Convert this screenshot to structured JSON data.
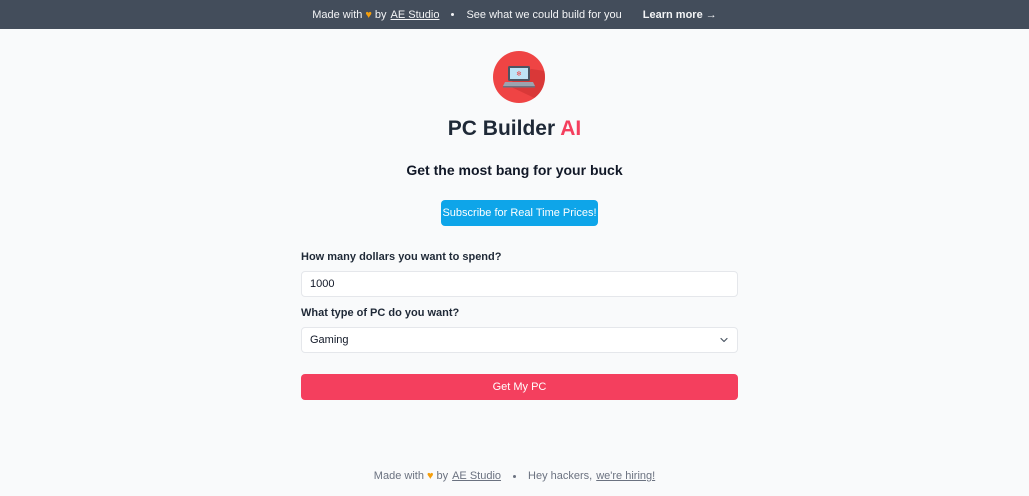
{
  "banner": {
    "made_with": "Made with",
    "heart_icon": "orange-heart",
    "by": "by",
    "studio_link": "AE Studio",
    "pitch": "See what we could build for you",
    "learn_more": "Learn more →"
  },
  "logo": {
    "icon": "laptop-icon",
    "bg_color": "#ef4444"
  },
  "title": {
    "main": "PC Builder",
    "accent": "AI",
    "accent_color": "#f43f5e"
  },
  "subtitle": "Get the most bang for your buck",
  "subscribe_button": "Subscribe for Real Time Prices!",
  "form": {
    "budget_label": "How many dollars you want to spend?",
    "budget_value": "1000",
    "type_label": "What type of PC do you want?",
    "type_selected": "Gaming"
  },
  "submit_button": "Get My PC",
  "footer": {
    "made_with": "Made with",
    "by": "by",
    "studio_link": "AE Studio",
    "hackers": "Hey hackers,",
    "hiring_link": "we're hiring!"
  },
  "colors": {
    "banner_bg": "#434d5b",
    "subscribe_bg": "#0ea5e9",
    "submit_bg": "#f43f5e"
  }
}
